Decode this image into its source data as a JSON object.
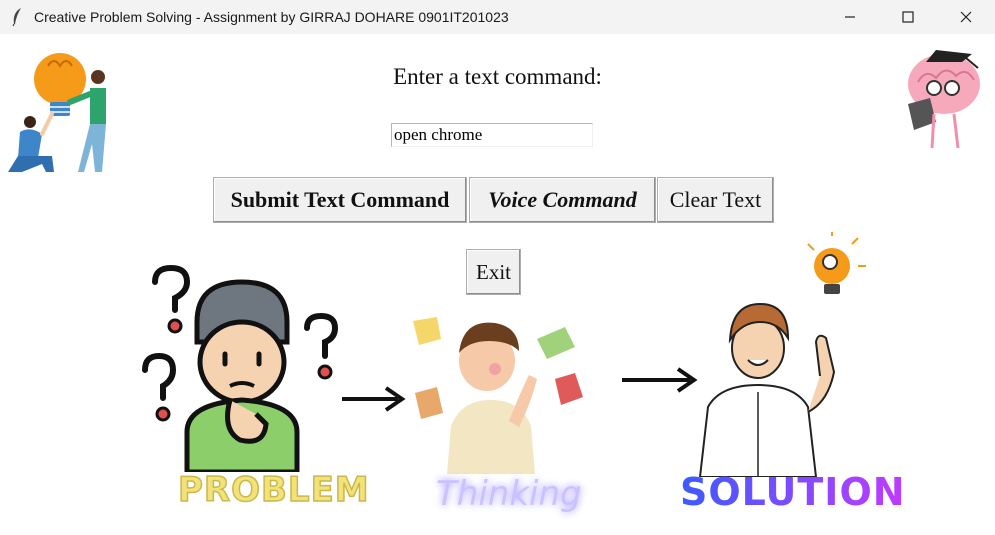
{
  "window": {
    "title": "Creative Problem Solving - Assignment by GIRRAJ DOHARE 0901IT201023",
    "controls": [
      "minimize-icon",
      "maximize-icon",
      "close-icon"
    ]
  },
  "main": {
    "prompt_label": "Enter a text command:",
    "command_input_value": "open chrome",
    "buttons": {
      "submit": "Submit Text Command",
      "voice": "Voice Command",
      "clear": "Clear Text",
      "exit": "Exit"
    }
  },
  "illustration": {
    "problem_label": "PROBLEM",
    "thinking_label": "Thinking",
    "solution_label": "SOLUTION",
    "colors": {
      "problem_text": "#f3e27a",
      "thinking_text": "#c9c2ff",
      "solution_start": "#3b5bff",
      "solution_end": "#c23bff",
      "bulb": "#f59a19",
      "skin": "#f6d3b0",
      "shirt_green": "#8ccf6a"
    },
    "icons": [
      "lightbulb-team-illustration",
      "brain-reading-illustration",
      "confused-boy-illustration",
      "thinking-boy-illustration",
      "idea-man-illustration"
    ]
  }
}
